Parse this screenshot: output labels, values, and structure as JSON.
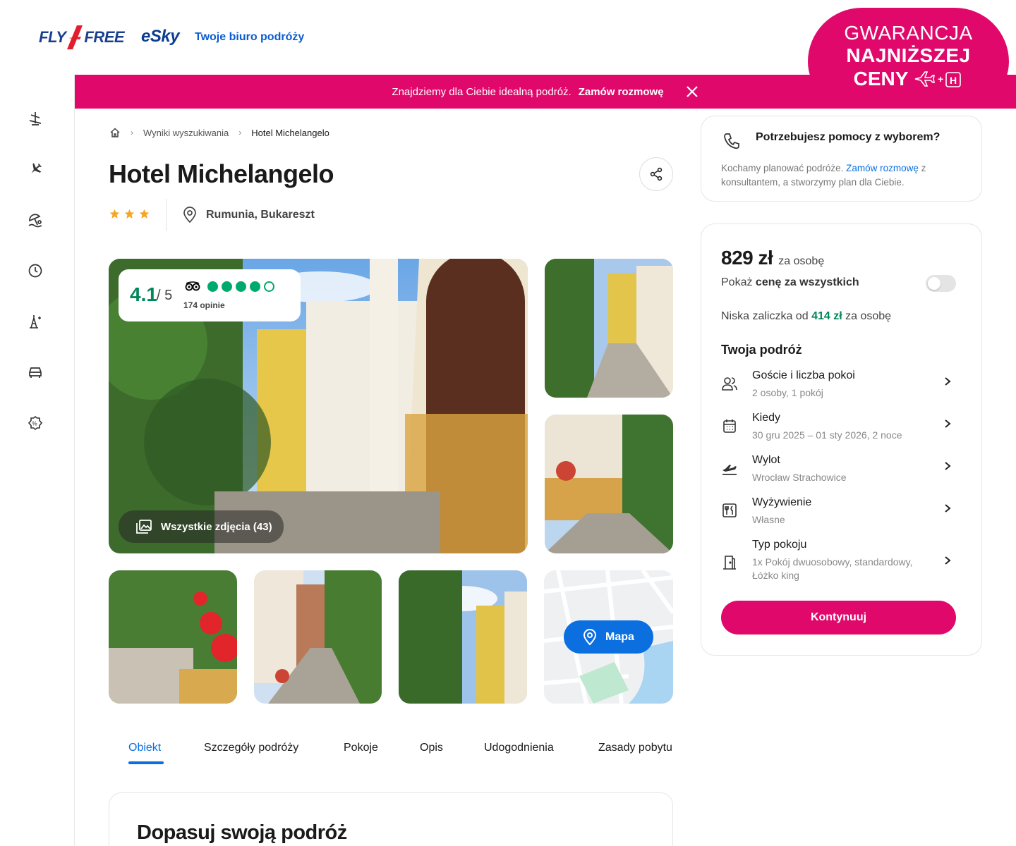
{
  "header": {
    "logo_fly": "FLY",
    "logo_free": "FREE",
    "logo_esky": "eSky",
    "tagline": "Twoje biuro podróży"
  },
  "guarantee": {
    "line1": "GWARANCJA",
    "line2": "NAJNIŻSZEJ",
    "line3": "CENY"
  },
  "promo": {
    "text": "Znajdziemy dla Ciebie idealną podróż.",
    "link": "Zamów rozmowę"
  },
  "sidebar": {
    "items": [
      "holiday-icon",
      "flight-icon",
      "beach-icon",
      "lastminute-icon",
      "city-break-icon",
      "car-icon",
      "deals-icon"
    ]
  },
  "breadcrumb": {
    "level1": "Wyniki wyszukiwania",
    "current": "Hotel Michelangelo"
  },
  "hotel": {
    "name": "Hotel Michelangelo",
    "stars": 3,
    "location": "Rumunia, Bukareszt"
  },
  "rating": {
    "score": "4.1",
    "outof": "/ 5",
    "reviews": "174 opinie",
    "bubbles": 4
  },
  "gallery": {
    "all_photos_label": "Wszystkie zdjęcia (43)",
    "map_label": "Mapa"
  },
  "tabs": [
    {
      "label": "Obiekt",
      "active": true
    },
    {
      "label": "Szczegóły podróży"
    },
    {
      "label": "Pokoje"
    },
    {
      "label": "Opis"
    },
    {
      "label": "Udogodnienia"
    },
    {
      "label": "Zasady pobytu"
    }
  ],
  "section_title": "Dopasuj swoją podróż",
  "help": {
    "title": "Potrzebujesz pomocy z wyborem?",
    "text_before": "Kochamy planować podróże.",
    "link": "Zamów rozmowę",
    "text_after": "z konsultantem, a stworzymy plan dla Ciebie."
  },
  "price": {
    "amount": "829 zł",
    "per": "za osobę",
    "show_all_prefix": "Pokaż",
    "show_all_bold": "cenę za wszystkich",
    "toggle_on": false,
    "deposit_prefix": "Niska zaliczka od",
    "deposit_amount": "414 zł",
    "deposit_suffix": "za osobę",
    "trip_title": "Twoja podróż",
    "rows": [
      {
        "label": "Goście i liczba pokoi",
        "value": "2 osoby, 1 pokój",
        "icon": "guests-icon"
      },
      {
        "label": "Kiedy",
        "value": "30 gru 2025 – 01 sty 2026, 2 noce",
        "icon": "calendar-icon"
      },
      {
        "label": "Wylot",
        "value": "Wrocław Strachowice",
        "icon": "departure-icon"
      },
      {
        "label": "Wyżywienie",
        "value": "Własne",
        "icon": "meal-icon"
      },
      {
        "label": "Typ pokoju",
        "value": "1x Pokój dwuosobowy, standardowy, Łóżko king",
        "icon": "room-door-icon"
      }
    ],
    "continue_label": "Kontynuuj"
  },
  "colors": {
    "brand_pink": "#e0096b",
    "accent_blue": "#0b6fe0",
    "rating_green": "#00aa6c"
  }
}
